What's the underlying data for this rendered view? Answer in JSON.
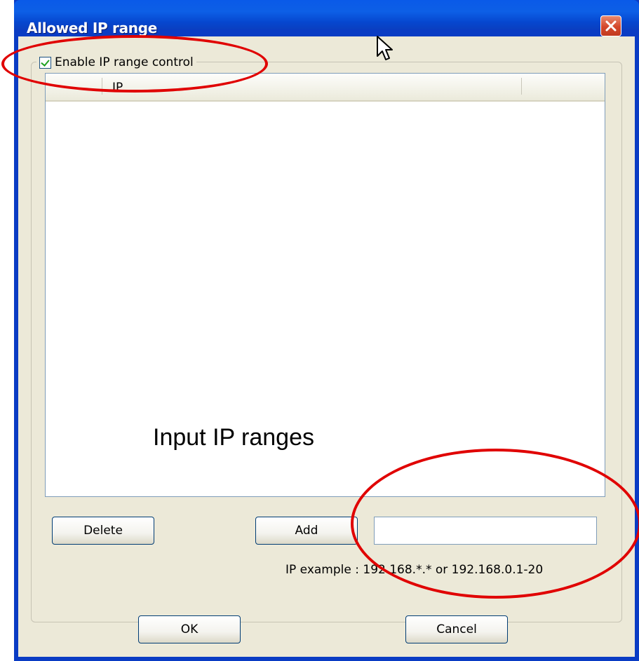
{
  "window": {
    "title": "Allowed IP range"
  },
  "group": {
    "checkbox_label": "Enable IP range control",
    "checked": true
  },
  "list": {
    "columns": [
      "IP"
    ]
  },
  "annotations": {
    "caption": "Input IP ranges",
    "color": "#e00000"
  },
  "buttons": {
    "delete": "Delete",
    "add": "Add",
    "ok": "OK",
    "cancel": "Cancel"
  },
  "ip_input": {
    "value": "",
    "example": "IP example : 192.168.*.* or  192.168.0.1-20"
  },
  "colors": {
    "titlebar": "#0a5ae8",
    "dialog_bg": "#ece9d8",
    "close": "#d4472a"
  }
}
